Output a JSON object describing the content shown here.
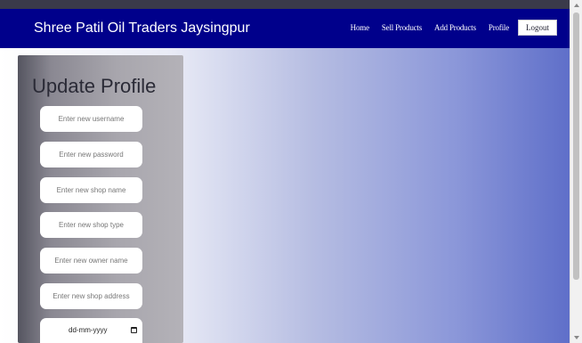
{
  "navbar": {
    "brand": "Shree Patil Oil Traders Jaysingpur",
    "links": [
      "Home",
      "Sell Products",
      "Add Products",
      "Profile"
    ],
    "logout_label": "Logout"
  },
  "profile_form": {
    "title": "Update Profile",
    "username_placeholder": "Enter new username",
    "password_placeholder": "Enter new password",
    "shop_name_placeholder": "Enter new shop name",
    "shop_type_placeholder": "Enter new shop type",
    "owner_name_placeholder": "Enter new owner name",
    "shop_address_placeholder": "Enter new shop address",
    "date_placeholder": "dd-mm-yyyy"
  },
  "colors": {
    "navbar_bg": "#00008b",
    "gradient_end": "#5f6fc9"
  }
}
